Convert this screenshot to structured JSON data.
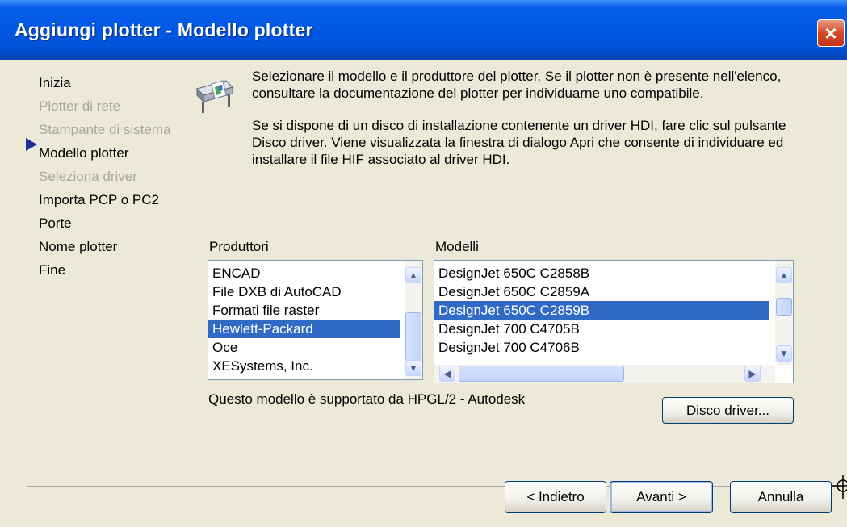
{
  "window": {
    "title": "Aggiungi plotter - Modello plotter",
    "close_glyph": "×"
  },
  "steps": [
    {
      "label": "Inizia",
      "enabled": true,
      "current": false
    },
    {
      "label": "Plotter di rete",
      "enabled": false,
      "current": false
    },
    {
      "label": "Stampante di sistema",
      "enabled": false,
      "current": false
    },
    {
      "label": "Modello plotter",
      "enabled": true,
      "current": true
    },
    {
      "label": "Seleziona driver",
      "enabled": false,
      "current": false
    },
    {
      "label": "Importa PCP o PC2",
      "enabled": true,
      "current": false
    },
    {
      "label": "Porte",
      "enabled": true,
      "current": false
    },
    {
      "label": "Nome plotter",
      "enabled": true,
      "current": false
    },
    {
      "label": "Fine",
      "enabled": true,
      "current": false
    }
  ],
  "description": {
    "paragraph1": "Selezionare il modello e il produttore del plotter. Se il plotter non è presente nell'elenco, consultare la documentazione del plotter per individuarne uno compatibile.",
    "paragraph2": "Se si dispone di un disco di installazione contenente un driver HDI, fare clic sul pulsante Disco driver. Viene visualizzata la finestra di dialogo Apri che consente di individuare ed installare il file HIF associato al driver HDI."
  },
  "manufacturers": {
    "label": "Produttori",
    "items": [
      "ENCAD",
      "File DXB di AutoCAD",
      "Formati file raster",
      "Hewlett-Packard",
      "Oce",
      "XESystems, Inc."
    ],
    "selected": "Hewlett-Packard"
  },
  "models": {
    "label": "Modelli",
    "items": [
      "DesignJet 650C C2858B",
      "DesignJet 650C C2859A",
      "DesignJet 650C C2859B",
      "DesignJet 700 C4705B",
      "DesignJet 700 C4706B"
    ],
    "selected": "DesignJet 650C C2859B"
  },
  "support_text": "Questo modello è supportato da HPGL/2 - Autodesk",
  "buttons": {
    "disk_driver": "Disco driver...",
    "back": "< Indietro",
    "next": "Avanti >",
    "cancel": "Annulla"
  },
  "colors": {
    "titlebar": "#0058e6",
    "selection": "#316ac5",
    "dialog_bg": "#ece9d8",
    "close_button": "#d44a26"
  }
}
